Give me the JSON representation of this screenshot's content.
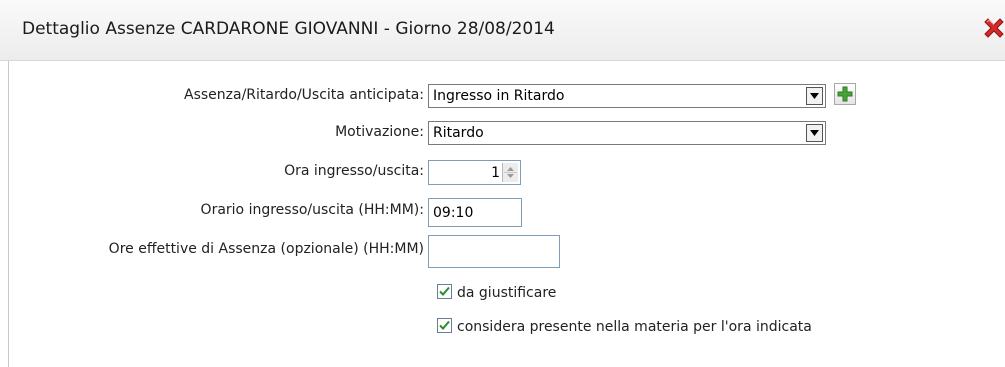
{
  "dialog": {
    "title": "Dettaglio Assenze CARDARONE GIOVANNI - Giorno 28/08/2014",
    "close_icon": "close-red-x-icon"
  },
  "form": {
    "assenza_label": "Assenza/Ritardo/Uscita anticipata:",
    "assenza_value": "Ingresso in Ritardo",
    "add_icon": "plus-icon",
    "motivazione_label": "Motivazione:",
    "motivazione_value": "Ritardo",
    "ora_label": "Ora ingresso/uscita:",
    "ora_value": "1",
    "orario_label": "Orario ingresso/uscita (HH:MM):",
    "orario_value": "09:10",
    "ore_effettive_label": "Ore effettive di Assenza (opzionale) (HH:MM)",
    "ore_effettive_value": "",
    "giustificare_label": "da giustificare",
    "giustificare_checked": true,
    "presente_label": "considera presente nella materia per l'ora indicata",
    "presente_checked": true
  },
  "colors": {
    "close_red": "#d42a2a",
    "plus_green": "#46a536",
    "check_green": "#2e8b2e"
  }
}
